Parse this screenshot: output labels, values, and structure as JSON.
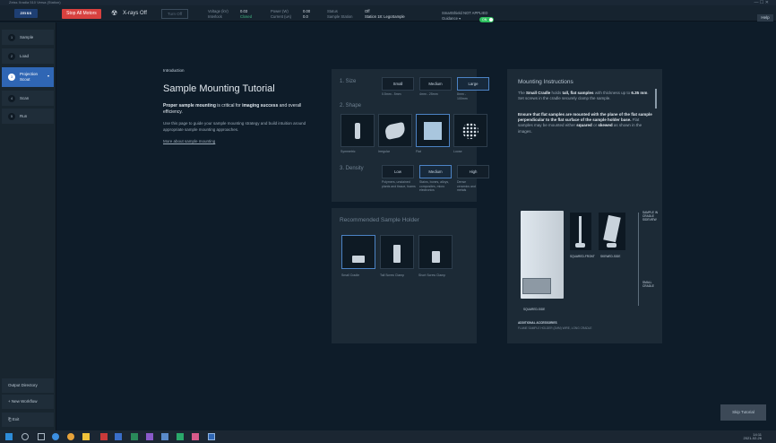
{
  "window": {
    "title": "Zeiss Xradia 510 Versa (Station)"
  },
  "topbar": {
    "logo": "ZEISS",
    "stop_all_motors": "Stop All Motors",
    "xrays_label": "X-rays Off",
    "turn_off": "Turn Off",
    "voltage_label": "Voltage (kV)",
    "voltage_value": "0.03",
    "interlock_label": "Interlock",
    "interlock_value": "Closed",
    "power_label": "Power (W)",
    "power_value": "0.00",
    "current_label": "Current (uA)",
    "current_value": "0.0",
    "status_label": "Status",
    "status_value": "Off",
    "sample_station_label": "Sample Station",
    "sample_station_value": "Station 18: LegoSample",
    "smartshield": "SmartShield  NOT APPLIED",
    "guidance": "Guidance ▾",
    "toggle_label": "ON",
    "help": "Help"
  },
  "sidebar": {
    "steps": [
      {
        "num": "1",
        "label": "Sample"
      },
      {
        "num": "2",
        "label": "Load"
      },
      {
        "num": "3",
        "label": "Projection",
        "label2": "Scout"
      },
      {
        "num": "4",
        "label": "Scan"
      },
      {
        "num": "5",
        "label": "Run"
      }
    ],
    "output_directory": "Output Directory",
    "new_workflow": "+ New Workflow",
    "exit": "Exit"
  },
  "intro": {
    "caption": "Introduction",
    "title": "Sample Mounting Tutorial",
    "lead_a": "Proper sample mounting",
    "lead_b": " is critical for ",
    "lead_c": "imaging success",
    "lead_d": " and overall efficiency.",
    "body": "Use this page to guide your sample mounting strategy and build intuition around appropriate sample mounting approaches.",
    "link": "More about sample mounting"
  },
  "size": {
    "title": "1. Size",
    "options": [
      "Small",
      "Medium",
      "Large"
    ],
    "ranges": [
      "0.5mm - 5mm",
      "4mm - 25mm",
      "8mm - 100mm"
    ]
  },
  "shape": {
    "title": "2. Shape",
    "options": [
      "Symmetric",
      "Irregular",
      "Flat",
      "Loose"
    ]
  },
  "density": {
    "title": "3. Density",
    "options": [
      "Low",
      "Medium",
      "High"
    ],
    "hints": [
      "Polymers, unstained plants and tissue, foams",
      "Stains, bones, alloys, composites, micro electronics",
      "Dense ceramics and metals"
    ]
  },
  "holder": {
    "title": "Recommended Sample Holder",
    "items": [
      "Small Cradle",
      "Tall Screw Clamp",
      "Short Screw Clamp"
    ]
  },
  "instructions": {
    "title": "Mounting Instructions",
    "p1_a": "The ",
    "p1_b": "Small Cradle",
    "p1_c": " holds ",
    "p1_d": "tall, flat samples",
    "p1_e": " with thickness up to ",
    "p1_f": "6.35 mm",
    "p1_g": ". Set screws in the cradle securely clamp the sample.",
    "p2_a": "Ensure that flat samples are mounted with the plane of the flat sample perpendicular to the flat surface of the sample holder base.",
    "p2_b": " Flat samples may be mounted either ",
    "p2_c": "squared",
    "p2_d": " or ",
    "p2_e": "skewed",
    "p2_f": " as shown in the images.",
    "fig": {
      "sample_label": "SAMPLE IN\nCRADLE SIDEVIEW",
      "squared_front": "SQUARED-FRONT",
      "skewed_side": "SKEWED-SIDE",
      "small_cradle": "SMALL CRADLE",
      "squared_side": "SQUARED-SIDE"
    },
    "accessories_title": "ADDITIONAL ACCESSORIES",
    "accessories": "FLAME SAMPLE HOLDER (2MM)   WIRE, LONG CRADLE"
  },
  "skip_tutorial": "Skip Tutorial",
  "taskbar": {
    "time": "14:11",
    "date": "2021-02-26"
  },
  "colors": {
    "accent": "#2f66b4",
    "danger": "#d8413f",
    "ok": "#2ec05f"
  }
}
